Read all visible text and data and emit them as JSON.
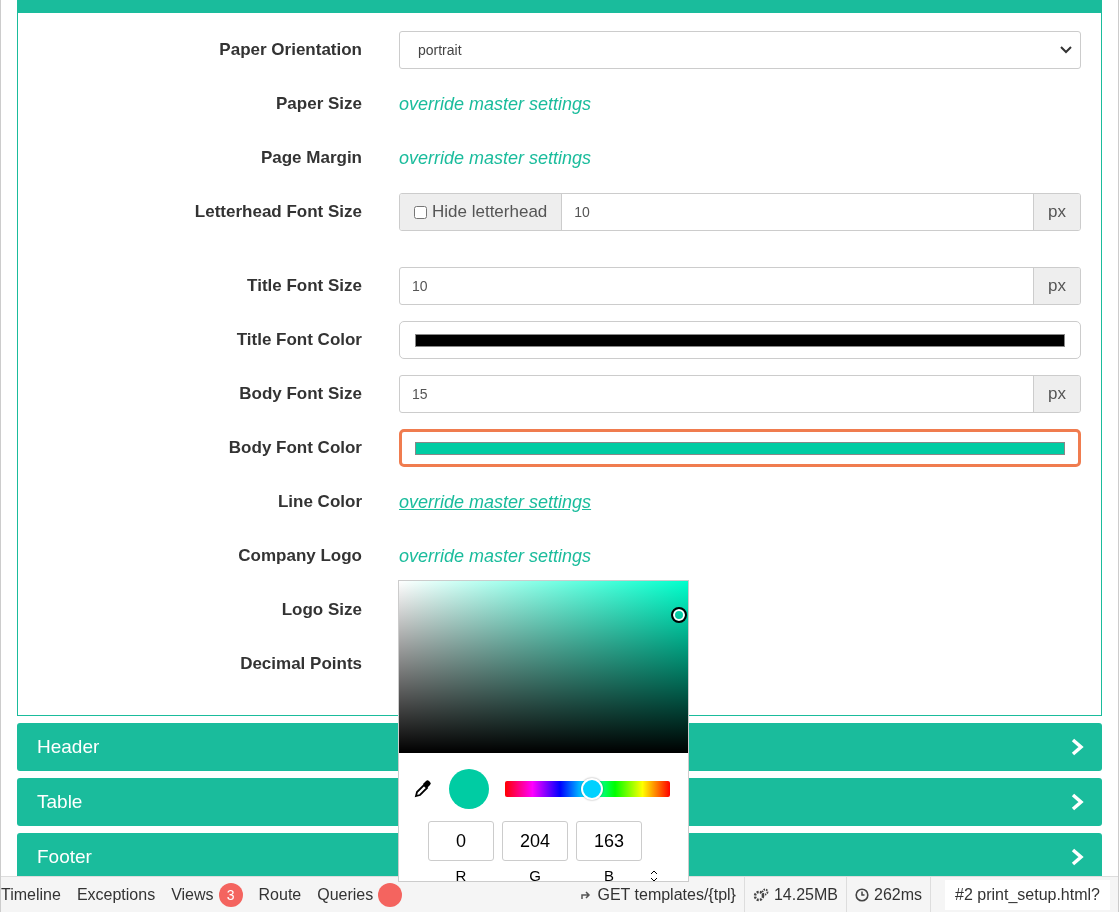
{
  "form_rows": [
    {
      "kind": "select",
      "label": "Paper Orientation",
      "value": "portrait"
    },
    {
      "kind": "link",
      "label": "Paper Size",
      "link": "override master settings",
      "underlined": false
    },
    {
      "kind": "link",
      "label": "Page Margin",
      "link": "override master settings",
      "underlined": false
    },
    {
      "kind": "checkbox_input",
      "label": "Letterhead Font Size",
      "checkbox_label": "Hide letterhead",
      "checked": false,
      "value": "10",
      "unit": "px"
    },
    {
      "kind": "spacer"
    },
    {
      "kind": "input",
      "label": "Title Font Size",
      "value": "10",
      "unit": "px"
    },
    {
      "kind": "color",
      "label": "Title Font Color",
      "color": "#000000",
      "focused": false
    },
    {
      "kind": "input",
      "label": "Body Font Size",
      "value": "15",
      "unit": "px"
    },
    {
      "kind": "color",
      "label": "Body Font Color",
      "color": "#00cca3",
      "focused": true
    },
    {
      "kind": "link",
      "label": "Line Color",
      "link": "override master settings",
      "underlined": true
    },
    {
      "kind": "link",
      "label": "Company Logo",
      "link": "override master settings",
      "underlined": false
    },
    {
      "kind": "label",
      "label": "Logo Size"
    },
    {
      "kind": "label",
      "label": "Decimal Points"
    }
  ],
  "sections": [
    {
      "title": "Header"
    },
    {
      "title": "Table"
    },
    {
      "title": "Footer"
    }
  ],
  "color_picker": {
    "hue": {
      "level": 0.53
    },
    "channels": [
      {
        "value": "0",
        "label": "R"
      },
      {
        "value": "204",
        "label": "G"
      },
      {
        "value": "163",
        "label": "B"
      }
    ]
  },
  "debug_bar": {
    "tabs": [
      {
        "label": "Timeline"
      },
      {
        "label": "Exceptions"
      },
      {
        "label": "Views",
        "badge": "3"
      },
      {
        "label": "Route"
      },
      {
        "label": "Queries",
        "badge_hidden": true
      }
    ],
    "request": "GET templates/{tpl}",
    "memory": "14.25MB",
    "time": "262ms",
    "current": "#2 print_setup.html?"
  }
}
